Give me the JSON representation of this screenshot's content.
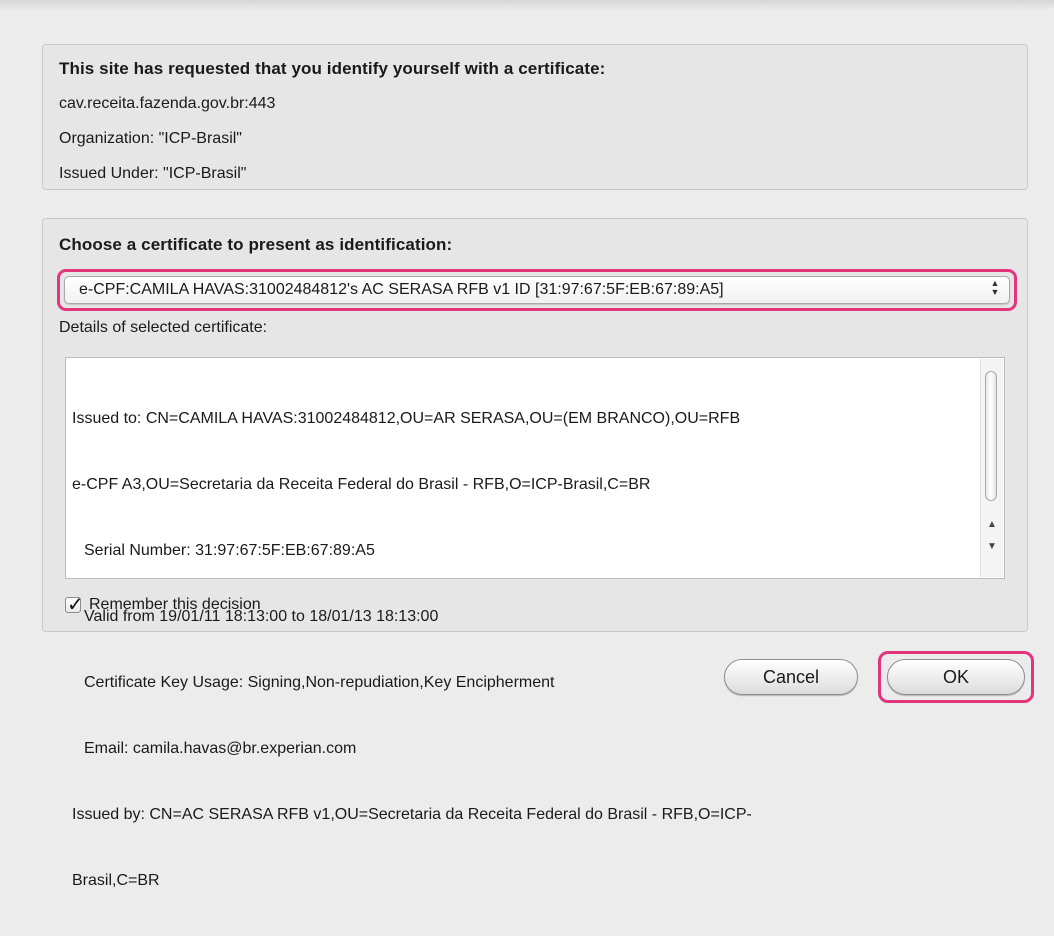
{
  "site_info": {
    "title": "This site has requested that you identify yourself with a certificate:",
    "host": "cav.receita.fazenda.gov.br:443",
    "organization": "Organization: \"ICP-Brasil\"",
    "issued_under": "Issued Under: \"ICP-Brasil\""
  },
  "certificate": {
    "choose_title": "Choose a certificate to present as identification:",
    "selected": "e-CPF:CAMILA HAVAS:31002484812's AC SERASA RFB v1 ID [31:97:67:5F:EB:67:89:A5]",
    "details_label": "Details of selected certificate:",
    "details_lines": [
      "Issued to: CN=CAMILA HAVAS:31002484812,OU=AR SERASA,OU=(EM BRANCO),OU=RFB",
      "e-CPF A3,OU=Secretaria da Receita Federal do Brasil - RFB,O=ICP-Brasil,C=BR",
      "Serial Number: 31:97:67:5F:EB:67:89:A5",
      "Valid from 19/01/11 18:13:00 to 18/01/13 18:13:00",
      "Certificate Key Usage: Signing,Non-repudiation,Key Encipherment",
      "Email: camila.havas@br.experian.com",
      "Issued by: CN=AC SERASA RFB v1,OU=Secretaria da Receita Federal do Brasil - RFB,O=ICP-",
      "Brasil,C=BR"
    ],
    "remember_label": "Remember this decision",
    "remember_checked": true
  },
  "buttons": {
    "cancel": "Cancel",
    "ok": "OK"
  },
  "colors": {
    "highlight": "#e2357e",
    "dialog_bg": "#ececec"
  }
}
